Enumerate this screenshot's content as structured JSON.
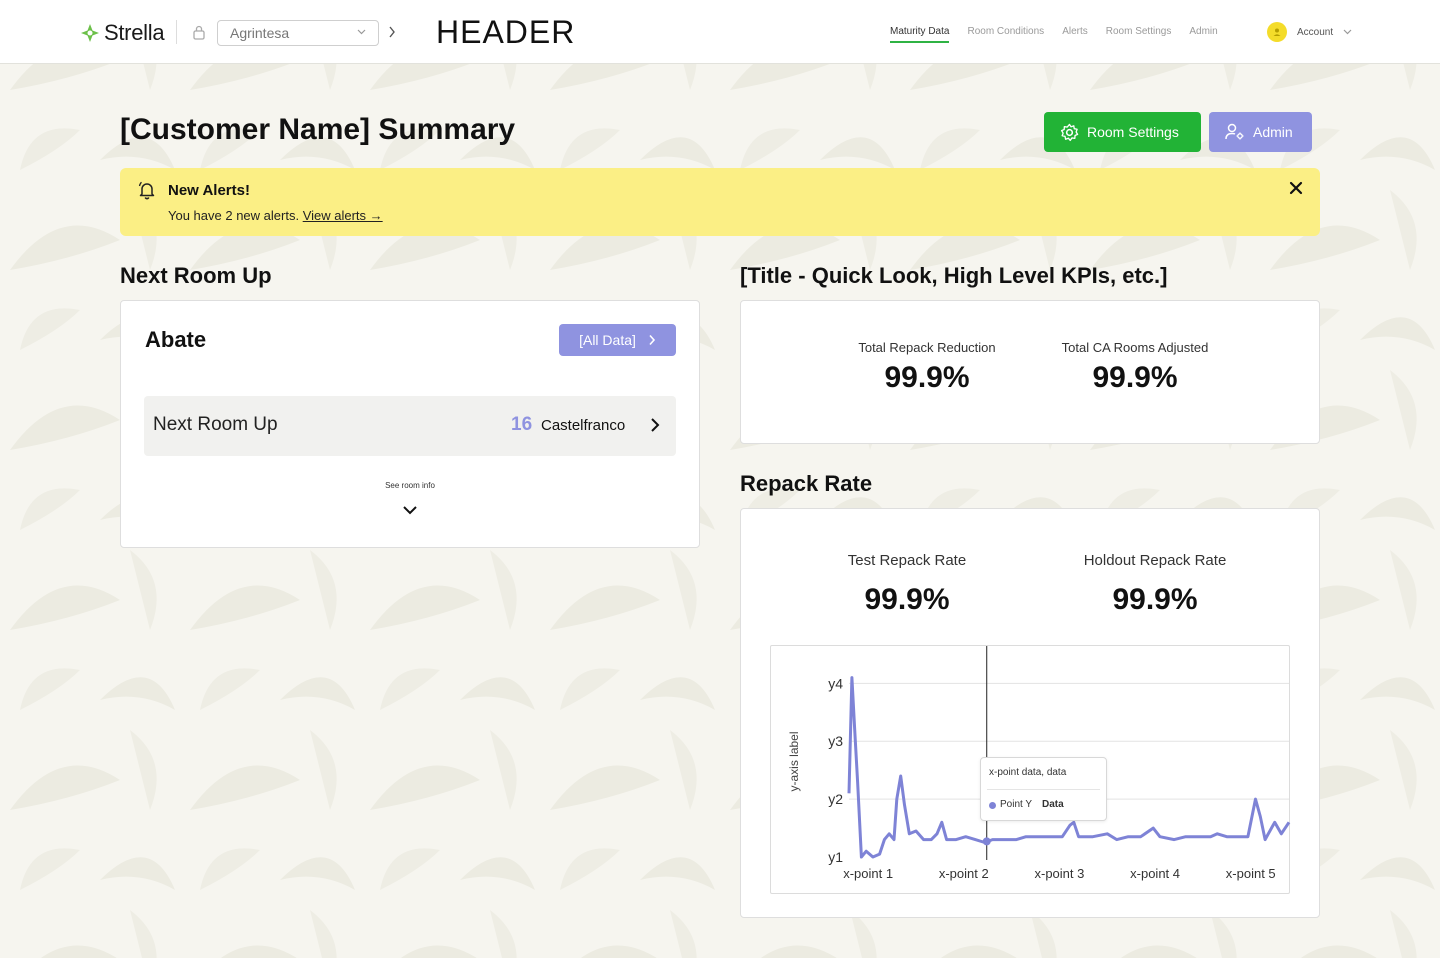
{
  "topbar": {
    "logo_text": "Strella",
    "org_select_value": "Agrintesa",
    "header_label": "HEADER",
    "nav": [
      "Maturity Data",
      "Room Conditions",
      "Alerts",
      "Room Settings",
      "Admin"
    ],
    "nav_active_index": 0,
    "account_label": "Account"
  },
  "page": {
    "title": "[Customer Name] Summary",
    "room_settings_button": "Room Settings",
    "admin_button": "Admin"
  },
  "alert": {
    "title": "New Alerts!",
    "text": "You have 2 new alerts.",
    "link": "View alerts →"
  },
  "next_room": {
    "section_title": "Next Room Up",
    "room_name": "Abate",
    "all_data_button": "[All Data]",
    "row_label": "Next Room Up",
    "room_number": "16",
    "room_location": "Castelfranco",
    "see_info": "See room info"
  },
  "kpis": {
    "section_title": "[Title - Quick Look, High Level KPIs, etc.]",
    "items": [
      {
        "label": "Total Repack Reduction",
        "value": "99.9%"
      },
      {
        "label": "Total CA Rooms Adjusted",
        "value": "99.9%"
      }
    ]
  },
  "repack": {
    "section_title": "Repack Rate",
    "items": [
      {
        "label": "Test Repack Rate",
        "value": "99.9%"
      },
      {
        "label": "Holdout Repack Rate",
        "value": "99.9%"
      }
    ]
  },
  "tooltip": {
    "title": "x-point data, data",
    "series_name": "Point Y",
    "value": "Data"
  },
  "chart_data": {
    "type": "line",
    "xlabel": "",
    "ylabel": "y-axis label",
    "x_ticks": [
      "x-point 1",
      "x-point 2",
      "x-point 3",
      "x-point 4",
      "x-point 5"
    ],
    "y_ticks": [
      "y1",
      "y2",
      "y3",
      "y4"
    ],
    "ylim": [
      1,
      4.3
    ],
    "xlim": [
      0.8,
      5.4
    ],
    "grid": true,
    "color": "#7e83d6",
    "hover_x": 2.24,
    "series": [
      {
        "values": [
          [
            0.8,
            2.1
          ],
          [
            0.83,
            4.1
          ],
          [
            0.86,
            3.2
          ],
          [
            0.89,
            2.3
          ],
          [
            0.93,
            1.0
          ],
          [
            0.98,
            1.1
          ],
          [
            1.05,
            1.0
          ],
          [
            1.12,
            1.05
          ],
          [
            1.17,
            1.3
          ],
          [
            1.22,
            1.4
          ],
          [
            1.27,
            1.3
          ],
          [
            1.3,
            2.0
          ],
          [
            1.34,
            2.4
          ],
          [
            1.38,
            1.9
          ],
          [
            1.43,
            1.4
          ],
          [
            1.5,
            1.45
          ],
          [
            1.58,
            1.3
          ],
          [
            1.66,
            1.3
          ],
          [
            1.72,
            1.4
          ],
          [
            1.77,
            1.6
          ],
          [
            1.82,
            1.3
          ],
          [
            1.92,
            1.3
          ],
          [
            2.02,
            1.35
          ],
          [
            2.12,
            1.3
          ],
          [
            2.22,
            1.25
          ],
          [
            2.3,
            1.3
          ],
          [
            2.42,
            1.3
          ],
          [
            2.55,
            1.3
          ],
          [
            2.65,
            1.35
          ],
          [
            2.78,
            1.35
          ],
          [
            2.92,
            1.35
          ],
          [
            3.03,
            1.35
          ],
          [
            3.11,
            1.55
          ],
          [
            3.15,
            1.6
          ],
          [
            3.2,
            1.35
          ],
          [
            3.35,
            1.35
          ],
          [
            3.5,
            1.4
          ],
          [
            3.6,
            1.3
          ],
          [
            3.72,
            1.35
          ],
          [
            3.85,
            1.35
          ],
          [
            3.98,
            1.5
          ],
          [
            4.05,
            1.35
          ],
          [
            4.2,
            1.3
          ],
          [
            4.32,
            1.35
          ],
          [
            4.45,
            1.35
          ],
          [
            4.58,
            1.35
          ],
          [
            4.65,
            1.4
          ],
          [
            4.75,
            1.35
          ],
          [
            4.88,
            1.35
          ],
          [
            4.97,
            1.35
          ],
          [
            5.05,
            2.0
          ],
          [
            5.1,
            1.7
          ],
          [
            5.15,
            1.3
          ],
          [
            5.25,
            1.6
          ],
          [
            5.32,
            1.4
          ],
          [
            5.4,
            1.6
          ]
        ]
      }
    ]
  }
}
